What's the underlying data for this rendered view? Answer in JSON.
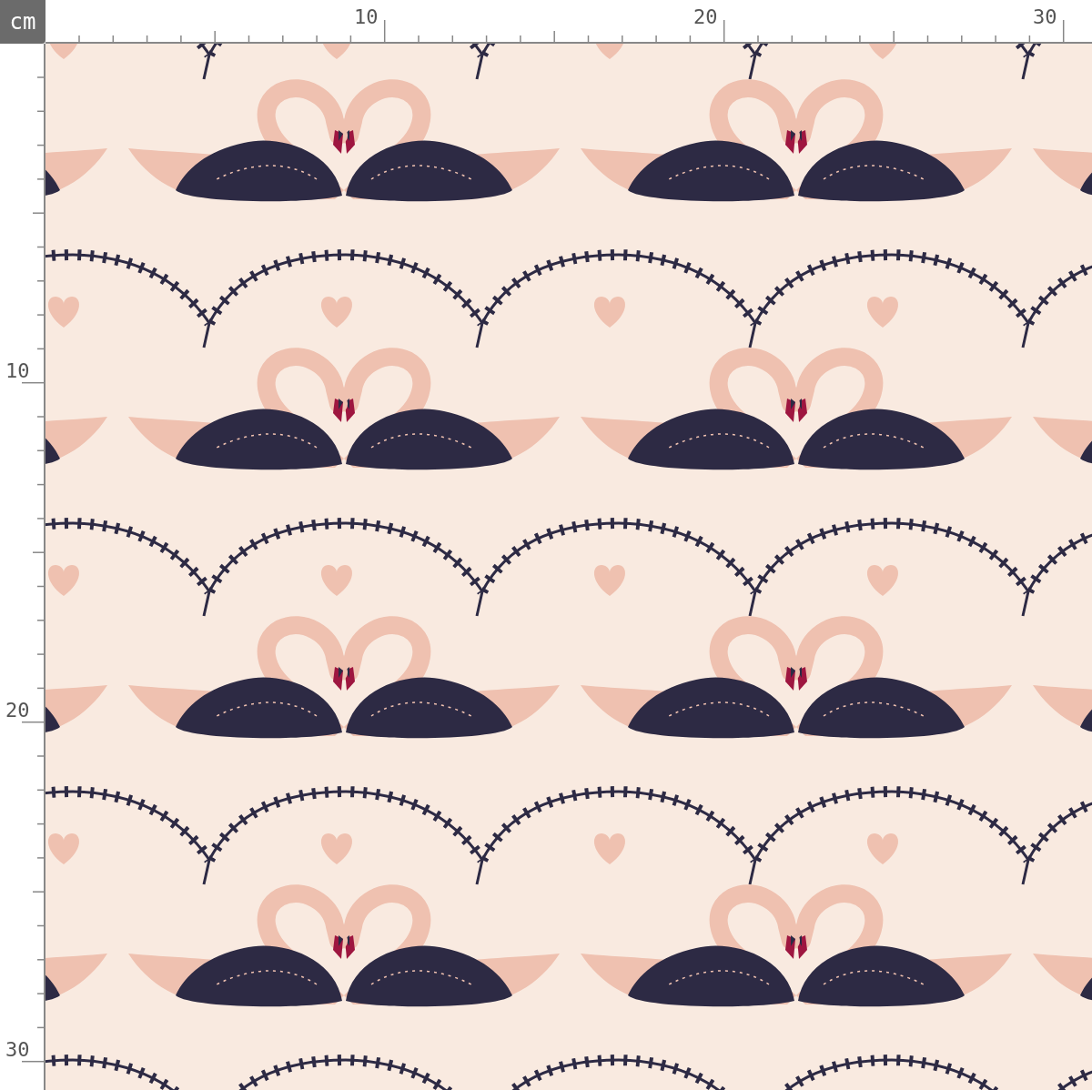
{
  "unit": "cm",
  "top_ruler": [
    "10",
    "20",
    "30"
  ],
  "left_ruler": [
    "10",
    "20",
    "30"
  ]
}
